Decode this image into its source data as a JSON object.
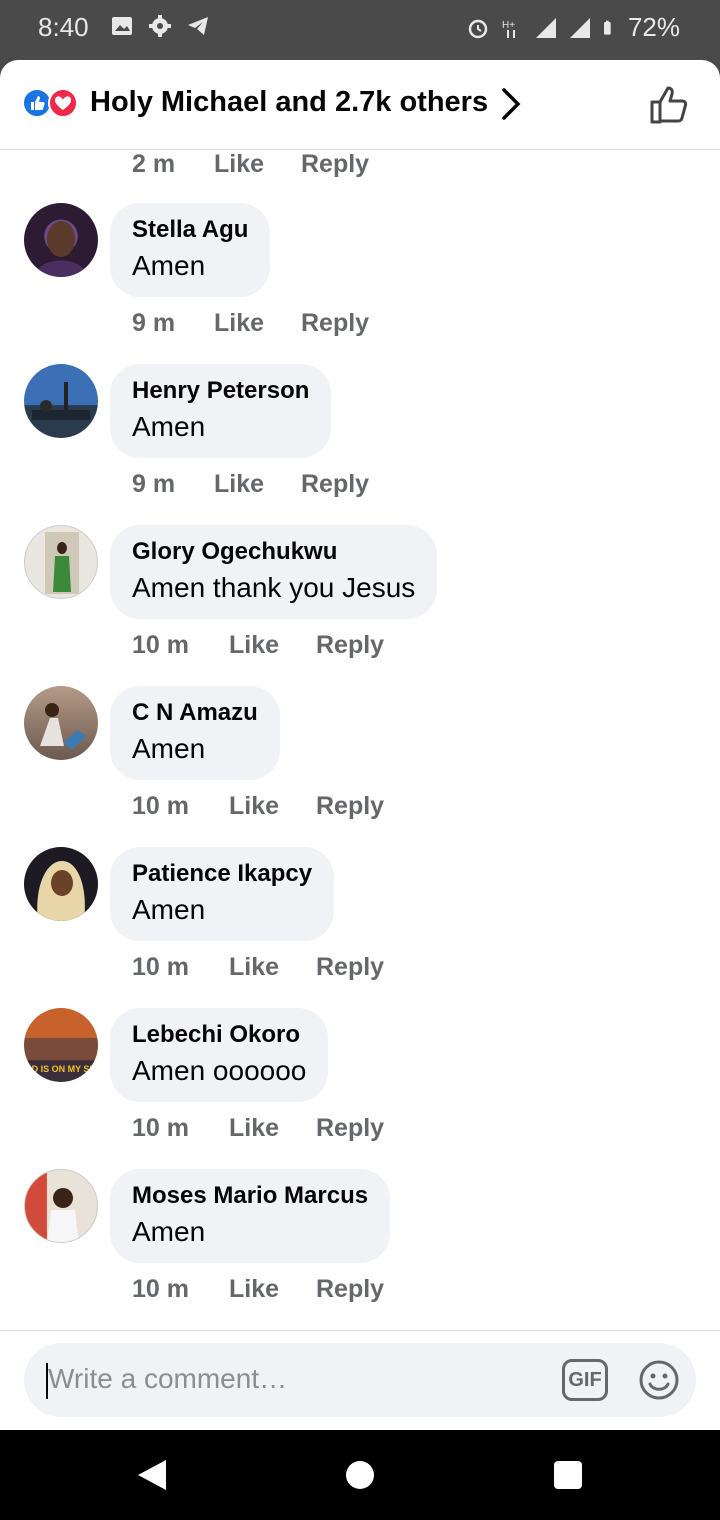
{
  "status_bar": {
    "time": "8:40",
    "battery": "72%",
    "icons": [
      "gallery-icon",
      "settings-icon",
      "telegram-icon",
      "alarm-icon",
      "network-hplus-icon",
      "signal-icon",
      "signal-icon",
      "battery-icon"
    ]
  },
  "header": {
    "reaction_summary": "Holy Michael and 2.7k others",
    "reaction_icons": [
      "like-reaction-icon",
      "love-reaction-icon"
    ],
    "colors": {
      "like": "#1b74e4",
      "love": "#f0284a"
    }
  },
  "previous_comment_meta": {
    "time": "2 m",
    "like": "Like",
    "reply": "Reply"
  },
  "comments": [
    {
      "name": "Stella Agu",
      "text": "Amen",
      "time": "9 m",
      "like": "Like",
      "reply": "Reply"
    },
    {
      "name": "Henry Peterson",
      "text": "Amen",
      "time": "9 m",
      "like": "Like",
      "reply": "Reply"
    },
    {
      "name": "Glory Ogechukwu",
      "text": "Amen thank you Jesus",
      "time": "10 m",
      "like": "Like",
      "reply": "Reply"
    },
    {
      "name": "C N Amazu",
      "text": "Amen",
      "time": "10 m",
      "like": "Like",
      "reply": "Reply"
    },
    {
      "name": "Patience Ikapcy",
      "text": "Amen",
      "time": "10 m",
      "like": "Like",
      "reply": "Reply"
    },
    {
      "name": "Lebechi Okoro",
      "text": "Amen oooooo",
      "time": "10 m",
      "like": "Like",
      "reply": "Reply"
    },
    {
      "name": "Moses Mario Marcus",
      "text": "Amen",
      "time": "10 m",
      "like": "Like",
      "reply": "Reply"
    }
  ],
  "avatar_badge_text": "GOD IS ON MY SIDE",
  "composer": {
    "placeholder": "Write a comment…",
    "gif_label": "GIF"
  }
}
